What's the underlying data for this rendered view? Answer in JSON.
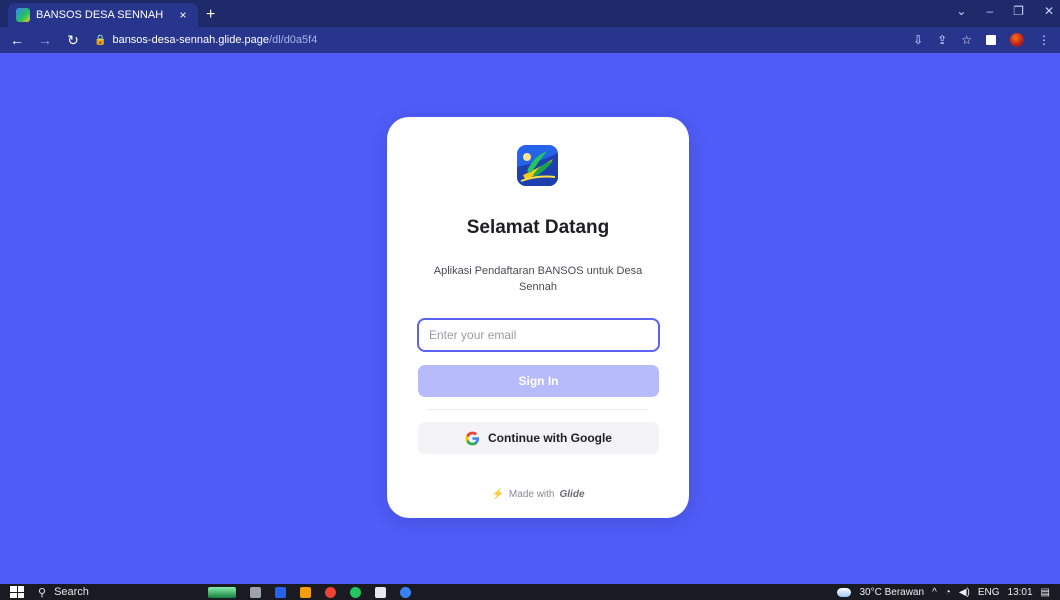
{
  "browser": {
    "tab_title": "BANSOS DESA SENNAH",
    "tab_close": "×",
    "new_tab": "+",
    "url_host": "bansos-desa-sennah.glide.page",
    "url_path": "/dl/d0a5f4"
  },
  "login": {
    "headline": "Selamat Datang",
    "subtitle": "Aplikasi Pendaftaran BANSOS untuk Desa Sennah",
    "email_placeholder": "Enter your email",
    "email_value": "",
    "signin_label": "Sign In",
    "google_label": "Continue with Google",
    "made_with_prefix": "Made with",
    "made_with_brand": "Glide"
  },
  "taskbar": {
    "search_label": "Search",
    "weather": "30°C Berawan",
    "language": "ENG",
    "time": "13:01"
  },
  "colors": {
    "background": "#4f5cf7",
    "accent": "#5a63f2",
    "signin_disabled": "#b7bbfb"
  }
}
